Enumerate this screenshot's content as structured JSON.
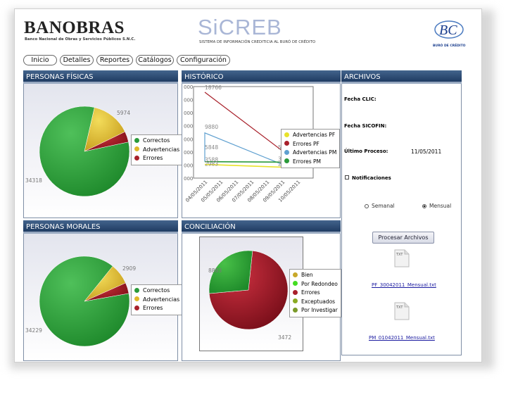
{
  "header": {
    "bank_name": "BANOBRAS",
    "bank_subtitle": "Banco Nacional de Obras y Servicios Públicos S.N.C.",
    "system_name": "SiCREB",
    "system_subtitle": "SISTEMA DE INFORMACIÓN CREDITICIA AL BURÓ DE CRÉDITO",
    "bureau_name": "BURÓ DE CRÉDITO"
  },
  "nav": {
    "items": [
      {
        "label": "Inicio"
      },
      {
        "label": "Detalles"
      },
      {
        "label": "Reportes"
      },
      {
        "label": "Catálogos"
      },
      {
        "label": "Configuración"
      }
    ]
  },
  "panels": {
    "personas_fisicas": "PERSONAS FÍSICAS",
    "historico": "HISTÓRICO",
    "archivos": "ARCHIVOS",
    "personas_morales": "PERSONAS MORALES",
    "conciliacion": "CONCILIACIÓN"
  },
  "colors": {
    "header_bar": "#2a4870",
    "green": "#2a9a3a",
    "yellow": "#e0b82a",
    "red": "#a8202a",
    "blue": "#5fa0d0",
    "lime": "#44dd22",
    "olive": "#8aaa22"
  },
  "chart_data": [
    {
      "id": "personas_fisicas",
      "type": "pie",
      "title": "",
      "series": [
        {
          "name": "Correctos",
          "value": 34318,
          "label": "34318"
        },
        {
          "name": "Advertencias",
          "value": 5974,
          "label": "5974"
        },
        {
          "name": "Errores",
          "value": 1600,
          "label": ""
        }
      ]
    },
    {
      "id": "historico",
      "type": "line",
      "title": "",
      "x": [
        "04/05/2011",
        "05/05/2011",
        "06/05/2011",
        "07/05/2011",
        "08/05/2011",
        "09/05/2011",
        "10/05/2011"
      ],
      "y_ticks": [
        "000",
        "000",
        "000",
        "000",
        "000",
        "000",
        "000",
        "000"
      ],
      "series": [
        {
          "name": "Advertencias PF",
          "points": [
            [
              "04/05/2011",
              2983
            ],
            [
              "09/05/2011",
              2383
            ]
          ]
        },
        {
          "name": "Errores PF",
          "points": [
            [
              "04/05/2011",
              18766
            ],
            [
              "09/05/2011",
              5974
            ]
          ]
        },
        {
          "name": "Advertencias PM",
          "points": [
            [
              "04/05/2011",
              9880
            ],
            [
              "09/05/2011",
              2983
            ]
          ]
        },
        {
          "name": "Errores PM",
          "points": [
            [
              "04/05/2011",
              3588
            ],
            [
              "09/05/2011",
              3485
            ]
          ]
        }
      ],
      "point_labels": [
        "18766",
        "9880",
        "5848",
        "3588",
        "2983",
        "5974",
        "3485",
        "2583"
      ]
    },
    {
      "id": "personas_morales",
      "type": "pie",
      "title": "",
      "series": [
        {
          "name": "Correctos",
          "value": 34229,
          "label": "34229"
        },
        {
          "name": "Advertencias",
          "value": 2909,
          "label": "2909"
        },
        {
          "name": "Errores",
          "value": 1500,
          "label": ""
        }
      ]
    },
    {
      "id": "conciliacion",
      "type": "pie",
      "title": "",
      "series": [
        {
          "name": "Bien",
          "value": 0,
          "label": ""
        },
        {
          "name": "Por Redondeo",
          "value": 0,
          "label": ""
        },
        {
          "name": "Errores",
          "value": 8883,
          "label": "8883"
        },
        {
          "name": "Exceptuados",
          "value": 0,
          "label": ""
        },
        {
          "name": "Por Investigar",
          "value": 3472,
          "label": "3472"
        }
      ]
    }
  ],
  "archivos": {
    "fecha_clic_label": "Fecha CLIC:",
    "fecha_sicofin_label": "Fecha SICOFIN:",
    "ultimo_proceso_label": "Último Proceso:",
    "ultimo_proceso_value": "11/05/2011",
    "notificaciones_label": "Notificaciones",
    "radio_semanal": "Semanal",
    "radio_mensual": "Mensual",
    "procesar_button": "Procesar Archivos",
    "file_icon_text": "TXT",
    "files": [
      "PF_30042011_Mensual.txt",
      "PM_01042011_Mensual.txt"
    ]
  }
}
